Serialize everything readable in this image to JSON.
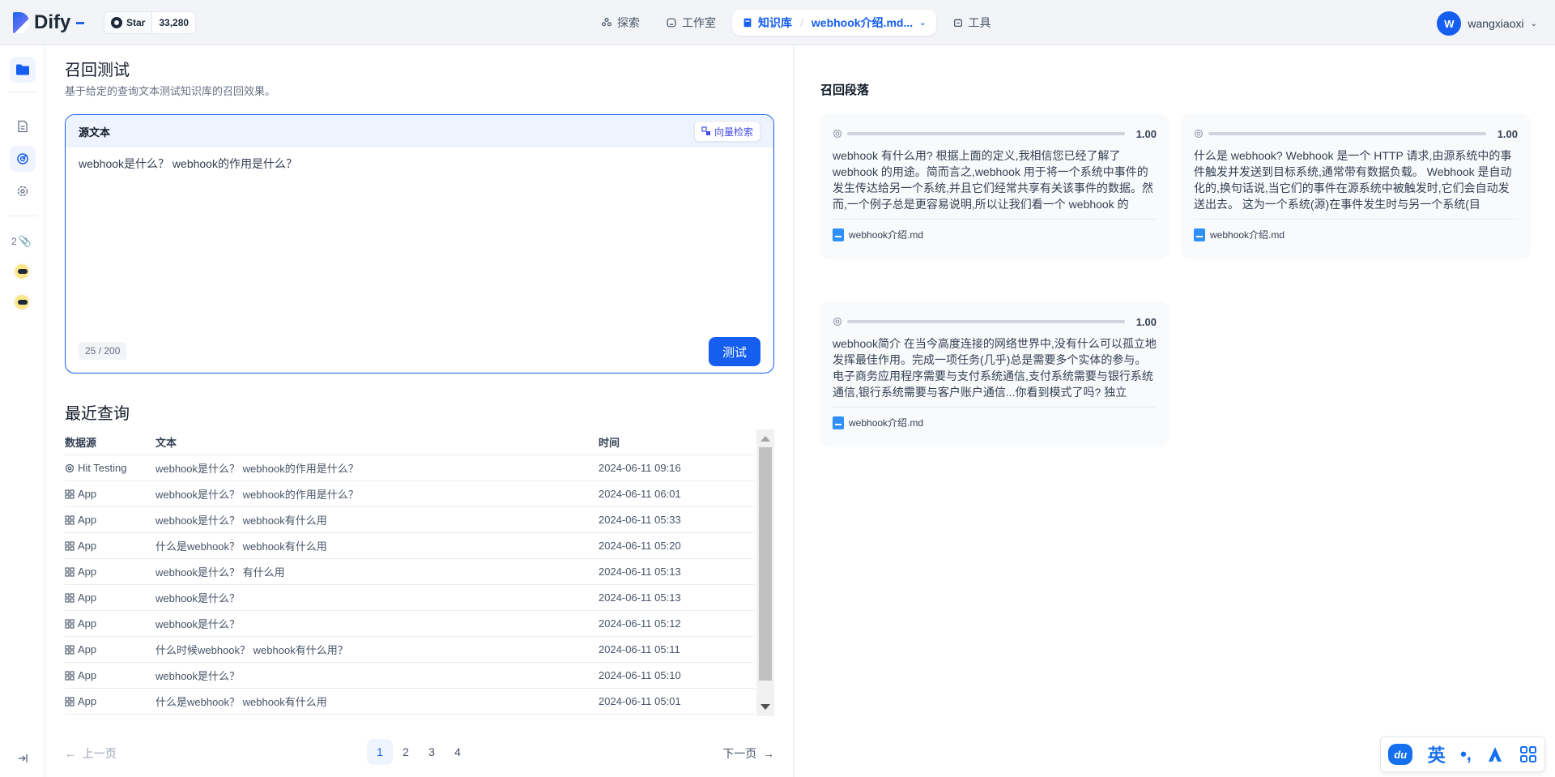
{
  "header": {
    "brand": "Dify",
    "github": {
      "star_label": "Star",
      "count": "33,280"
    },
    "nav": [
      {
        "label": "探索",
        "icon": "explore-icon"
      },
      {
        "label": "工作室",
        "icon": "studio-icon"
      },
      {
        "label": "知识库",
        "sub": "webhook介绍.md...",
        "icon": "knowledge-icon"
      },
      {
        "label": "工具",
        "icon": "tools-icon"
      }
    ],
    "user": {
      "initial": "W",
      "name": "wangxiaoxi"
    }
  },
  "sidebar": {
    "attachment_count": "2"
  },
  "hit_testing": {
    "title": "召回测试",
    "description": "基于给定的查询文本测试知识库的召回效果。",
    "source_label": "源文本",
    "search_mode": "向量检索",
    "query_text": "webhook是什么？ webhook的作用是什么？",
    "char_count": "25 / 200",
    "test_button": "测试"
  },
  "recent": {
    "title": "最近查询",
    "columns": [
      "数据源",
      "文本",
      "时间"
    ],
    "rows": [
      {
        "source": "Hit Testing",
        "text": "webhook是什么？ webhook的作用是什么？",
        "time": "2024-06-11 09:16"
      },
      {
        "source": "App",
        "text": "webhook是什么？ webhook的作用是什么？",
        "time": "2024-06-11 06:01"
      },
      {
        "source": "App",
        "text": "webhook是什么？ webhook有什么用",
        "time": "2024-06-11 05:33"
      },
      {
        "source": "App",
        "text": "什么是webhook？ webhook有什么用",
        "time": "2024-06-11 05:20"
      },
      {
        "source": "App",
        "text": "webhook是什么？ 有什么用",
        "time": "2024-06-11 05:13"
      },
      {
        "source": "App",
        "text": "webhook是什么？",
        "time": "2024-06-11 05:13"
      },
      {
        "source": "App",
        "text": "webhook是什么？",
        "time": "2024-06-11 05:12"
      },
      {
        "source": "App",
        "text": "什么时候webhook？ webhook有什么用？",
        "time": "2024-06-11 05:11"
      },
      {
        "source": "App",
        "text": "webhook是什么？",
        "time": "2024-06-11 05:10"
      },
      {
        "source": "App",
        "text": "什么是webhook？ webhook有什么用",
        "time": "2024-06-11 05:01"
      }
    ]
  },
  "pagination": {
    "prev": "上一页",
    "next": "下一页",
    "pages": [
      "1",
      "2",
      "3",
      "4"
    ],
    "current": "1"
  },
  "results": {
    "title": "召回段落",
    "cards": [
      {
        "score": "1.00",
        "text": "webhook 有什么用? 根据上面的定义,我相信您已经了解了 webhook 的用途。简而言之,webhook 用于将一个系统中事件的发生传达给另一个系统,并且它们经常共享有关该事件的数据。然而,一个例子总是更容易说明,所以让我们看一个 webhook 的",
        "file": "webhook介绍.md"
      },
      {
        "score": "1.00",
        "text": "什么是 webhook? Webhook 是一个 HTTP 请求,由源系统中的事件触发并发送到目标系统,通常带有数据负载。 Webhook 是自动化的,换句话说,当它们的事件在源系统中被触发时,它们会自动发送出去。 这为一个系统(源)在事件发生时与另一个系统(目",
        "file": "webhook介绍.md"
      },
      {
        "score": "1.00",
        "text": "webhook简介 在当今高度连接的网络世界中,没有什么可以孤立地发挥最佳作用。完成一项任务(几乎)总是需要多个实体的参与。电子商务应用程序需要与支付系统通信,支付系统需要与银行系统通信,银行系统需要与客户账户通信...你看到模式了吗? 独立",
        "file": "webhook介绍.md"
      }
    ]
  },
  "ime": {
    "logo": "du",
    "lang": "英",
    "punct": "•,"
  }
}
